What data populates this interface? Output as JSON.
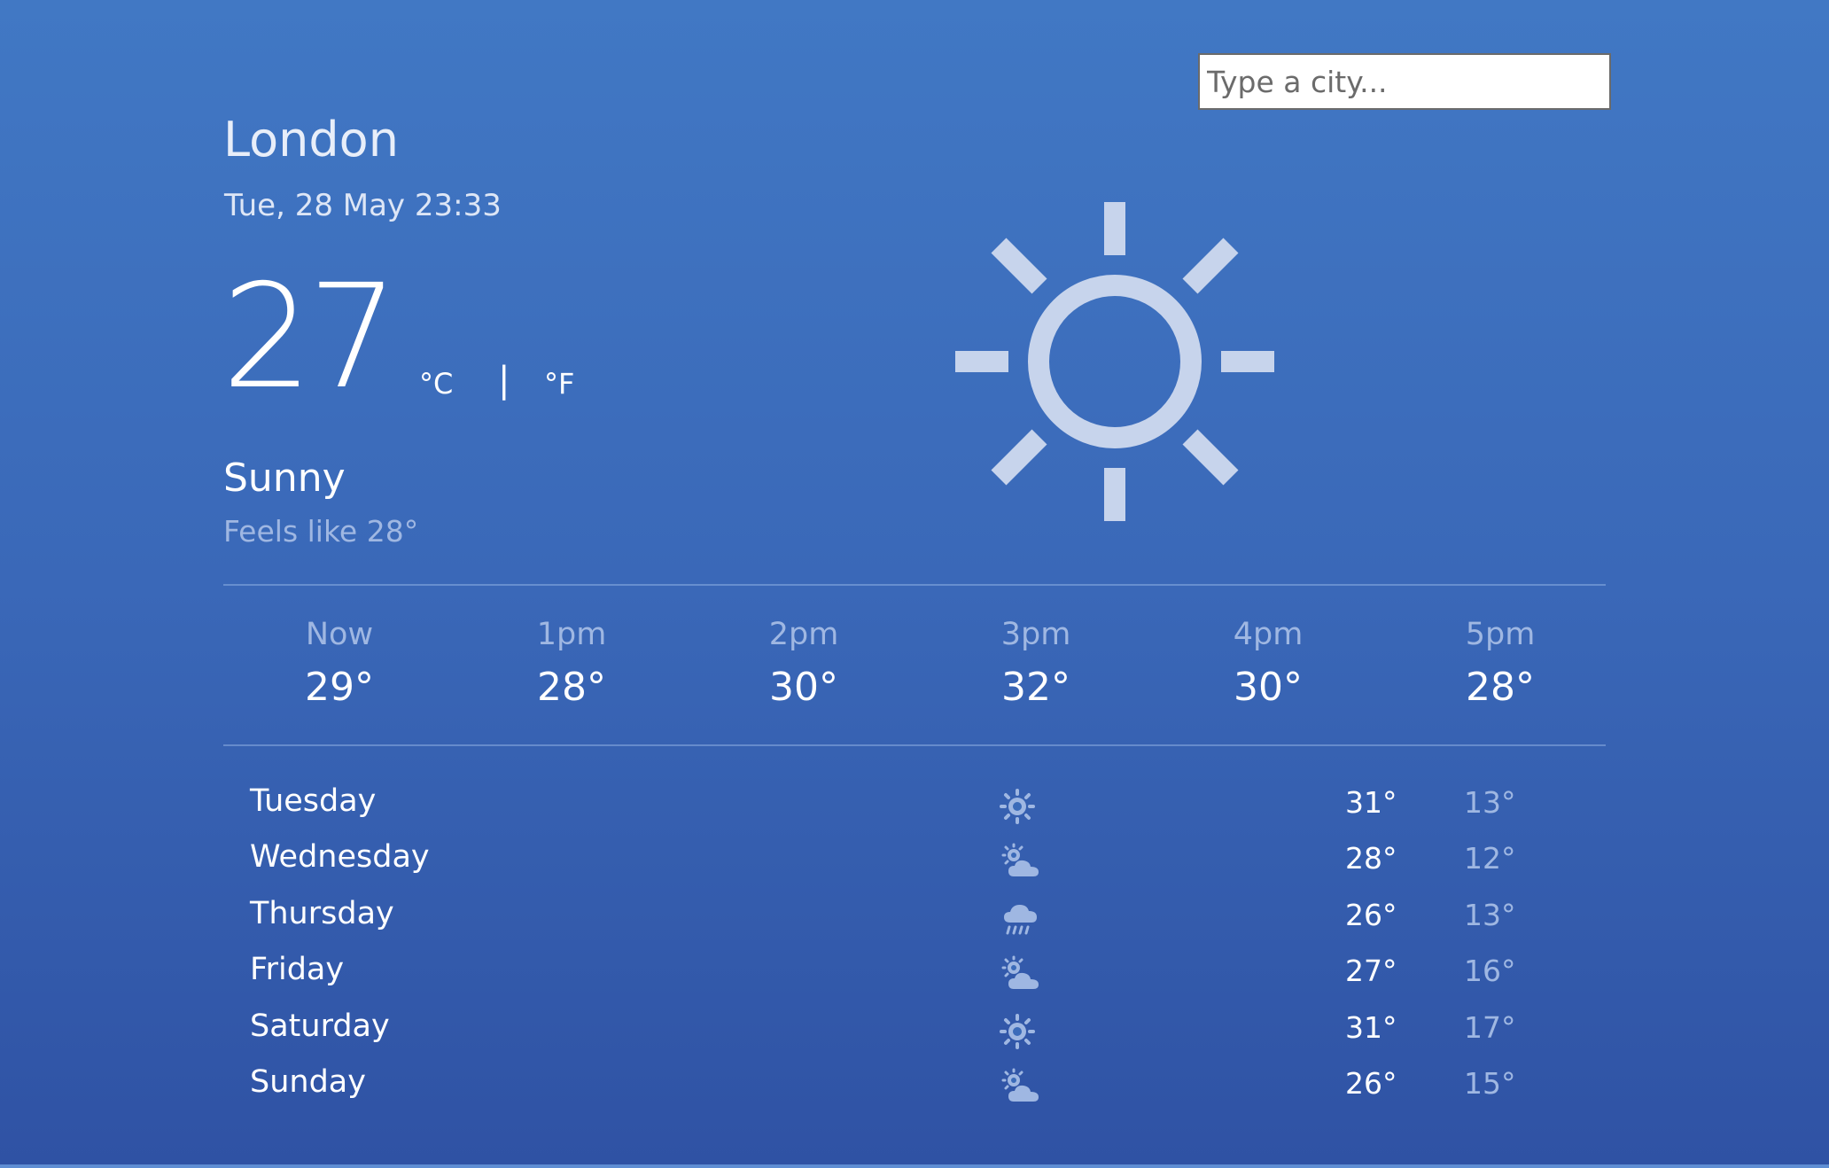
{
  "search": {
    "placeholder": "Type a city..."
  },
  "current": {
    "city": "London",
    "datetime": "Tue, 28 May 23:33",
    "temperature": "27",
    "unit_c": "°C",
    "unit_separator": "|",
    "unit_f": "°F",
    "condition": "Sunny",
    "feels_like": "Feels like 28°",
    "icon": "sun-icon"
  },
  "hourly": [
    {
      "label": "Now",
      "temp": "29°"
    },
    {
      "label": "1pm",
      "temp": "28°"
    },
    {
      "label": "2pm",
      "temp": "30°"
    },
    {
      "label": "3pm",
      "temp": "32°"
    },
    {
      "label": "4pm",
      "temp": "30°"
    },
    {
      "label": "5pm",
      "temp": "28°"
    }
  ],
  "daily": [
    {
      "day": "Tuesday",
      "icon": "sun-icon",
      "high": "31°",
      "low": "13°"
    },
    {
      "day": "Wednesday",
      "icon": "sun-cloud-icon",
      "high": "28°",
      "low": "12°"
    },
    {
      "day": "Thursday",
      "icon": "rain-cloud-icon",
      "high": "26°",
      "low": "13°"
    },
    {
      "day": "Friday",
      "icon": "sun-cloud-icon",
      "high": "27°",
      "low": "16°"
    },
    {
      "day": "Saturday",
      "icon": "sun-icon",
      "high": "31°",
      "low": "17°"
    },
    {
      "day": "Sunday",
      "icon": "sun-cloud-icon",
      "high": "26°",
      "low": "15°"
    }
  ],
  "colors": {
    "background_top": "#4178c4",
    "background_bottom": "#2f52a4",
    "muted_text": "#9fb7e2",
    "icon_fill": "#c7d4ec"
  }
}
